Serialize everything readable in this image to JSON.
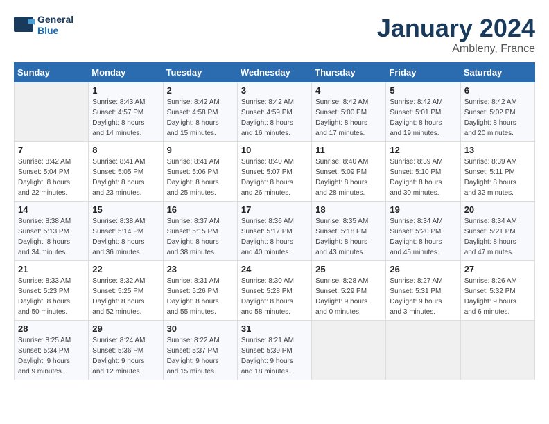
{
  "logo": {
    "line1": "General",
    "line2": "Blue"
  },
  "title": "January 2024",
  "location": "Ambleny, France",
  "weekdays": [
    "Sunday",
    "Monday",
    "Tuesday",
    "Wednesday",
    "Thursday",
    "Friday",
    "Saturday"
  ],
  "weeks": [
    [
      {
        "day": "",
        "info": ""
      },
      {
        "day": "1",
        "info": "Sunrise: 8:43 AM\nSunset: 4:57 PM\nDaylight: 8 hours\nand 14 minutes."
      },
      {
        "day": "2",
        "info": "Sunrise: 8:42 AM\nSunset: 4:58 PM\nDaylight: 8 hours\nand 15 minutes."
      },
      {
        "day": "3",
        "info": "Sunrise: 8:42 AM\nSunset: 4:59 PM\nDaylight: 8 hours\nand 16 minutes."
      },
      {
        "day": "4",
        "info": "Sunrise: 8:42 AM\nSunset: 5:00 PM\nDaylight: 8 hours\nand 17 minutes."
      },
      {
        "day": "5",
        "info": "Sunrise: 8:42 AM\nSunset: 5:01 PM\nDaylight: 8 hours\nand 19 minutes."
      },
      {
        "day": "6",
        "info": "Sunrise: 8:42 AM\nSunset: 5:02 PM\nDaylight: 8 hours\nand 20 minutes."
      }
    ],
    [
      {
        "day": "7",
        "info": "Sunrise: 8:42 AM\nSunset: 5:04 PM\nDaylight: 8 hours\nand 22 minutes."
      },
      {
        "day": "8",
        "info": "Sunrise: 8:41 AM\nSunset: 5:05 PM\nDaylight: 8 hours\nand 23 minutes."
      },
      {
        "day": "9",
        "info": "Sunrise: 8:41 AM\nSunset: 5:06 PM\nDaylight: 8 hours\nand 25 minutes."
      },
      {
        "day": "10",
        "info": "Sunrise: 8:40 AM\nSunset: 5:07 PM\nDaylight: 8 hours\nand 26 minutes."
      },
      {
        "day": "11",
        "info": "Sunrise: 8:40 AM\nSunset: 5:09 PM\nDaylight: 8 hours\nand 28 minutes."
      },
      {
        "day": "12",
        "info": "Sunrise: 8:39 AM\nSunset: 5:10 PM\nDaylight: 8 hours\nand 30 minutes."
      },
      {
        "day": "13",
        "info": "Sunrise: 8:39 AM\nSunset: 5:11 PM\nDaylight: 8 hours\nand 32 minutes."
      }
    ],
    [
      {
        "day": "14",
        "info": "Sunrise: 8:38 AM\nSunset: 5:13 PM\nDaylight: 8 hours\nand 34 minutes."
      },
      {
        "day": "15",
        "info": "Sunrise: 8:38 AM\nSunset: 5:14 PM\nDaylight: 8 hours\nand 36 minutes."
      },
      {
        "day": "16",
        "info": "Sunrise: 8:37 AM\nSunset: 5:15 PM\nDaylight: 8 hours\nand 38 minutes."
      },
      {
        "day": "17",
        "info": "Sunrise: 8:36 AM\nSunset: 5:17 PM\nDaylight: 8 hours\nand 40 minutes."
      },
      {
        "day": "18",
        "info": "Sunrise: 8:35 AM\nSunset: 5:18 PM\nDaylight: 8 hours\nand 43 minutes."
      },
      {
        "day": "19",
        "info": "Sunrise: 8:34 AM\nSunset: 5:20 PM\nDaylight: 8 hours\nand 45 minutes."
      },
      {
        "day": "20",
        "info": "Sunrise: 8:34 AM\nSunset: 5:21 PM\nDaylight: 8 hours\nand 47 minutes."
      }
    ],
    [
      {
        "day": "21",
        "info": "Sunrise: 8:33 AM\nSunset: 5:23 PM\nDaylight: 8 hours\nand 50 minutes."
      },
      {
        "day": "22",
        "info": "Sunrise: 8:32 AM\nSunset: 5:25 PM\nDaylight: 8 hours\nand 52 minutes."
      },
      {
        "day": "23",
        "info": "Sunrise: 8:31 AM\nSunset: 5:26 PM\nDaylight: 8 hours\nand 55 minutes."
      },
      {
        "day": "24",
        "info": "Sunrise: 8:30 AM\nSunset: 5:28 PM\nDaylight: 8 hours\nand 58 minutes."
      },
      {
        "day": "25",
        "info": "Sunrise: 8:28 AM\nSunset: 5:29 PM\nDaylight: 9 hours\nand 0 minutes."
      },
      {
        "day": "26",
        "info": "Sunrise: 8:27 AM\nSunset: 5:31 PM\nDaylight: 9 hours\nand 3 minutes."
      },
      {
        "day": "27",
        "info": "Sunrise: 8:26 AM\nSunset: 5:32 PM\nDaylight: 9 hours\nand 6 minutes."
      }
    ],
    [
      {
        "day": "28",
        "info": "Sunrise: 8:25 AM\nSunset: 5:34 PM\nDaylight: 9 hours\nand 9 minutes."
      },
      {
        "day": "29",
        "info": "Sunrise: 8:24 AM\nSunset: 5:36 PM\nDaylight: 9 hours\nand 12 minutes."
      },
      {
        "day": "30",
        "info": "Sunrise: 8:22 AM\nSunset: 5:37 PM\nDaylight: 9 hours\nand 15 minutes."
      },
      {
        "day": "31",
        "info": "Sunrise: 8:21 AM\nSunset: 5:39 PM\nDaylight: 9 hours\nand 18 minutes."
      },
      {
        "day": "",
        "info": ""
      },
      {
        "day": "",
        "info": ""
      },
      {
        "day": "",
        "info": ""
      }
    ]
  ]
}
